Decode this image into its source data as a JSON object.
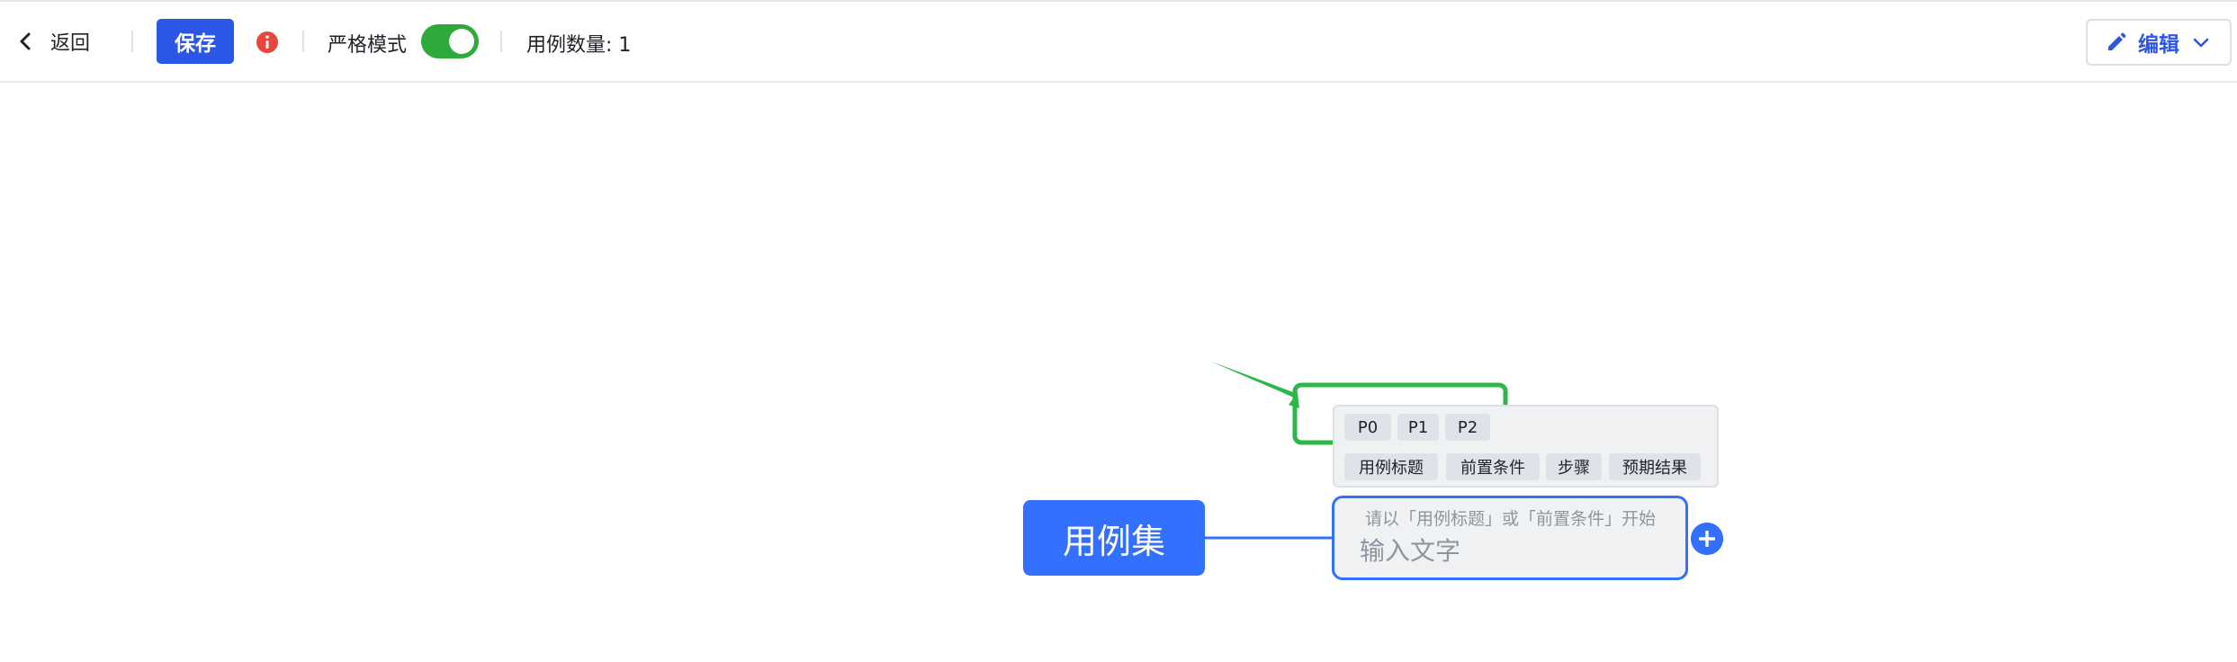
{
  "toolbar": {
    "back_label": "返回",
    "save_label": "保存",
    "strict_mode_label": "严格模式",
    "strict_mode_on": true,
    "case_count_label": "用例数量: 1",
    "edit_label": "编辑"
  },
  "mindmap": {
    "root_label": "用例集",
    "child_hint": "请以「用例标题」或「前置条件」开始",
    "child_placeholder": "输入文字"
  },
  "priority_tags": [
    "P0",
    "P1",
    "P2"
  ],
  "type_tags": [
    "用例标题",
    "前置条件",
    "步骤",
    "预期结果"
  ],
  "colors": {
    "primary": "#2c57e6",
    "node_blue": "#3370ff",
    "toggle_green": "#2eaa3b",
    "info_red": "#e8453c",
    "highlight_green": "#2fb64a"
  },
  "icons": {
    "back": "chevron-left-icon",
    "info": "info-circle-icon",
    "edit": "pencil-icon",
    "dropdown": "chevron-down-icon",
    "add": "plus-circle-icon"
  }
}
